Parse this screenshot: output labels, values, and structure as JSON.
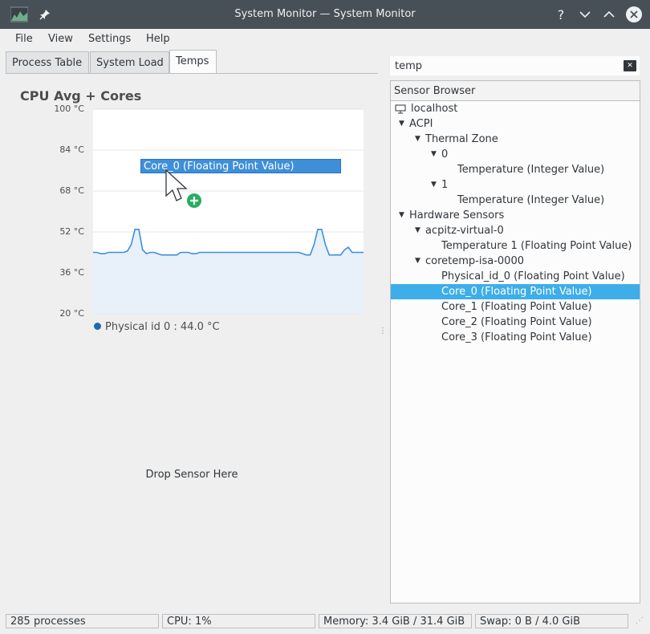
{
  "window": {
    "title": "System Monitor — System Monitor",
    "app_icon": "system-monitor-icon",
    "pin_icon": "pin-icon",
    "buttons": [
      "help-icon",
      "minimize-icon",
      "maximize-icon",
      "close-icon"
    ],
    "help_glyph": "?",
    "minimize_glyph": "﹀",
    "maximize_glyph": "︿",
    "close_glyph": "✕"
  },
  "menu": {
    "file": "File",
    "view": "View",
    "settings": "Settings",
    "help": "Help"
  },
  "tabs": [
    {
      "label": "Process Table",
      "active": false
    },
    {
      "label": "System Load",
      "active": false
    },
    {
      "label": "Temps",
      "active": true
    }
  ],
  "panel": {
    "title": "CPU Avg + Cores",
    "legend": "Physical id 0 : 44.0 °C",
    "drop_label": "Drop Sensor Here",
    "drag_label": "Core_0 (Floating Point Value)"
  },
  "chart_data": {
    "type": "area",
    "title": "CPU Avg + Cores",
    "xlabel": "",
    "ylabel": "",
    "ylim": [
      20,
      100
    ],
    "yticks": [
      "100 °C",
      "84 °C",
      "68 °C",
      "52 °C",
      "36 °C",
      "20 °C"
    ],
    "grid": true,
    "legend_position": "bottom",
    "colors": {
      "line": "#3d8ee0",
      "fill": "#e8f0fa",
      "legend_dot": "#1d6ab3"
    },
    "series": [
      {
        "name": "Physical id 0 : 44.0 °C",
        "values": [
          44,
          44,
          43.5,
          43.5,
          44,
          44,
          44,
          44,
          44,
          44.5,
          47,
          53,
          53,
          45,
          43.5,
          44,
          44,
          43.5,
          43,
          43,
          43,
          43,
          43,
          44,
          44,
          44,
          43.5,
          43.5,
          44,
          44,
          44,
          44,
          44,
          44,
          44,
          44,
          44,
          44,
          44,
          44,
          44,
          44,
          44,
          44,
          44,
          44,
          44,
          44,
          44,
          44,
          44,
          44,
          44,
          44,
          44,
          43.5,
          43,
          43,
          47,
          53,
          53,
          47,
          43,
          43,
          43,
          43,
          45,
          46,
          44,
          44,
          44,
          44
        ]
      }
    ]
  },
  "search": {
    "value": "temp",
    "clear_icon": "clear-text-icon"
  },
  "sensor_browser": {
    "header": "Sensor Browser",
    "rows": [
      {
        "label": "localhost",
        "indent": 0,
        "arrow": "",
        "icon": "computer-icon",
        "selected": false
      },
      {
        "label": "ACPI",
        "indent": 0,
        "arrow": "▼",
        "selected": false
      },
      {
        "label": "Thermal Zone",
        "indent": 1,
        "arrow": "▼",
        "selected": false
      },
      {
        "label": "0",
        "indent": 2,
        "arrow": "▼",
        "selected": false
      },
      {
        "label": "Temperature (Integer Value)",
        "indent": 3,
        "arrow": "",
        "selected": false
      },
      {
        "label": "1",
        "indent": 2,
        "arrow": "▼",
        "selected": false
      },
      {
        "label": "Temperature (Integer Value)",
        "indent": 3,
        "arrow": "",
        "selected": false
      },
      {
        "label": "Hardware Sensors",
        "indent": 0,
        "arrow": "▼",
        "selected": false
      },
      {
        "label": "acpitz-virtual-0",
        "indent": 1,
        "arrow": "▼",
        "selected": false
      },
      {
        "label": "Temperature 1 (Floating Point Value)",
        "indent": 2,
        "arrow": "",
        "selected": false
      },
      {
        "label": "coretemp-isa-0000",
        "indent": 1,
        "arrow": "▼",
        "selected": false
      },
      {
        "label": "Physical_id_0 (Floating Point Value)",
        "indent": 2,
        "arrow": "",
        "selected": false
      },
      {
        "label": "Core_0 (Floating Point Value)",
        "indent": 2,
        "arrow": "",
        "selected": true
      },
      {
        "label": "Core_1 (Floating Point Value)",
        "indent": 2,
        "arrow": "",
        "selected": false
      },
      {
        "label": "Core_2 (Floating Point Value)",
        "indent": 2,
        "arrow": "",
        "selected": false
      },
      {
        "label": "Core_3 (Floating Point Value)",
        "indent": 2,
        "arrow": "",
        "selected": false
      }
    ]
  },
  "status": {
    "processes": "285 processes",
    "cpu": "CPU: 1%",
    "memory": "Memory: 3.4 GiB / 31.4 GiB",
    "swap": "Swap: 0 B / 4.0 GiB"
  }
}
